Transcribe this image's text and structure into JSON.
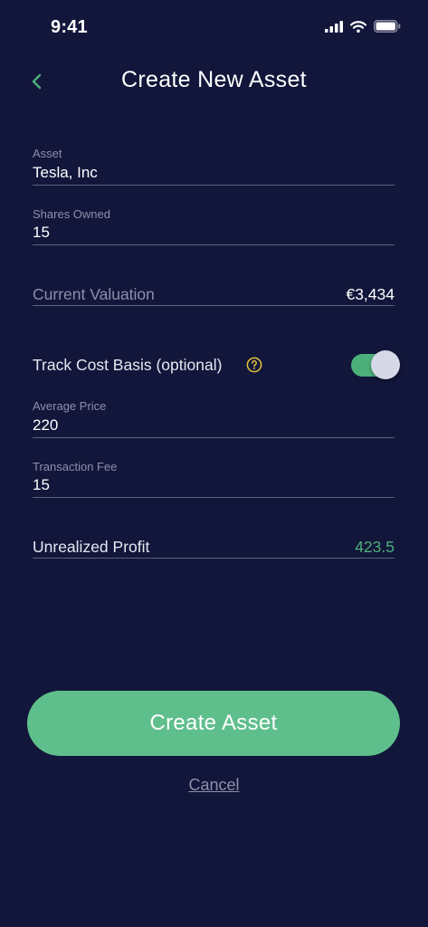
{
  "status_bar": {
    "time": "9:41",
    "icons": [
      "cellular-signal-icon",
      "wifi-icon",
      "battery-icon"
    ]
  },
  "nav": {
    "title": "Create New Asset",
    "back_icon": "chevron-left-icon"
  },
  "form": {
    "asset": {
      "label": "Asset",
      "value": "Tesla, Inc"
    },
    "shares_owned": {
      "label": "Shares Owned",
      "value": "15"
    },
    "current_valuation": {
      "label": "Current Valuation",
      "value": "€3,434"
    },
    "track_cost_basis": {
      "label": "Track Cost Basis (optional)",
      "enabled": true,
      "help_icon": "question-circle-icon"
    },
    "average_price": {
      "label": "Average Price",
      "value": "220"
    },
    "transaction_fee": {
      "label": "Transaction Fee",
      "value": "15"
    },
    "unrealized_profit": {
      "label": "Unrealized Profit",
      "value": "423.5"
    }
  },
  "actions": {
    "create_label": "Create Asset",
    "cancel_label": "Cancel"
  },
  "colors": {
    "background": "#12163a",
    "accent_green": "#5fbf8c",
    "profit_green": "#4cb07a",
    "help_icon_yellow": "#e6c53a",
    "muted_text": "#8c90aa"
  }
}
